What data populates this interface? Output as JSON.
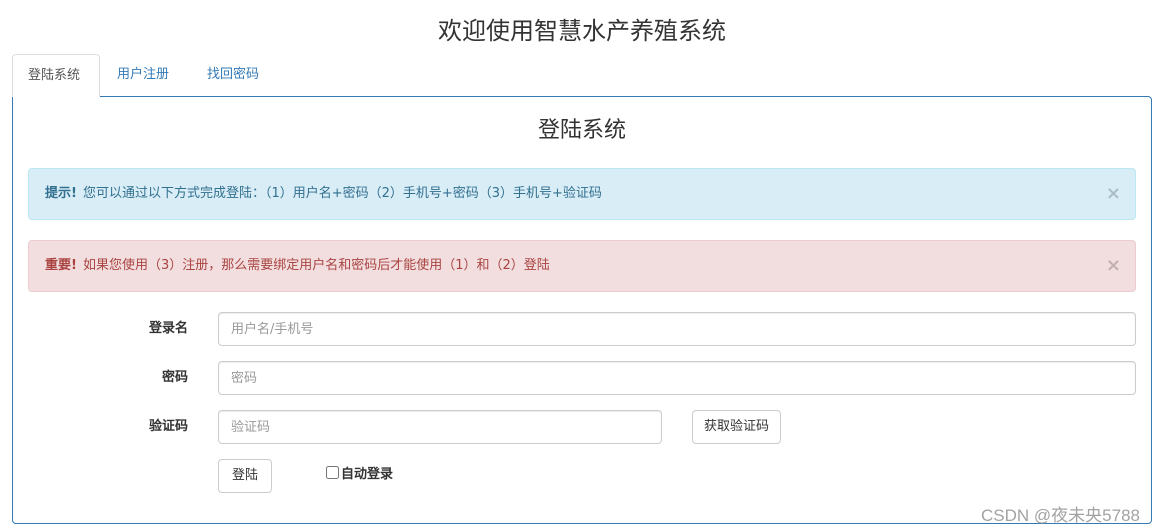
{
  "page": {
    "title": "欢迎使用智慧水产养殖系统"
  },
  "tabs": [
    {
      "label": "登陆系统",
      "active": true
    },
    {
      "label": "用户注册",
      "active": false
    },
    {
      "label": "找回密码",
      "active": false
    }
  ],
  "panel": {
    "title": "登陆系统"
  },
  "alerts": {
    "info": {
      "strong": "提示!",
      "text": "您可以通过以下方式完成登陆：（1）用户名+密码（2）手机号+密码（3）手机号+验证码",
      "close": "×"
    },
    "danger": {
      "strong": "重要!",
      "text": "如果您使用（3）注册，那么需要绑定用户名和密码后才能使用（1）和（2）登陆",
      "close": "×"
    }
  },
  "form": {
    "username": {
      "label": "登录名",
      "placeholder": "用户名/手机号",
      "value": ""
    },
    "password": {
      "label": "密码",
      "placeholder": "密码",
      "value": ""
    },
    "captcha": {
      "label": "验证码",
      "placeholder": "验证码",
      "value": ""
    },
    "get_code_button": "获取验证码",
    "login_button": "登陆",
    "remember": {
      "label": "自动登录",
      "checked": false
    }
  },
  "colors": {
    "link": "#337ab7",
    "info_bg": "#d9edf7",
    "danger_bg": "#f2dede",
    "panel_border": "#337ab7"
  },
  "watermark": "CSDN @夜未央5788"
}
